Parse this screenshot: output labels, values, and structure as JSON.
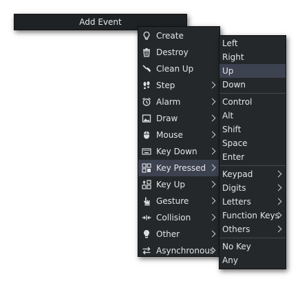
{
  "add_event_label": "Add Event",
  "event_menu": {
    "items": [
      {
        "label": "Create",
        "icon": "lightbulb-icon",
        "submenu": false
      },
      {
        "label": "Destroy",
        "icon": "trash-icon",
        "submenu": false
      },
      {
        "label": "Clean Up",
        "icon": "broom-icon",
        "submenu": false
      },
      {
        "label": "Step",
        "icon": "footprints-icon",
        "submenu": true
      },
      {
        "label": "Alarm",
        "icon": "alarm-clock-icon",
        "submenu": true
      },
      {
        "label": "Draw",
        "icon": "picture-icon",
        "submenu": true
      },
      {
        "label": "Mouse",
        "icon": "mouse-icon",
        "submenu": true
      },
      {
        "label": "Key Down",
        "icon": "keyboard-icon",
        "submenu": true
      },
      {
        "label": "Key Pressed",
        "icon": "key-pressed-icon",
        "submenu": true,
        "highlighted": true
      },
      {
        "label": "Key Up",
        "icon": "key-up-icon",
        "submenu": true
      },
      {
        "label": "Gesture",
        "icon": "hand-pointer-icon",
        "submenu": true
      },
      {
        "label": "Collision",
        "icon": "collision-arrows-icon",
        "submenu": true
      },
      {
        "label": "Other",
        "icon": "lightbulb-filled-icon",
        "submenu": true
      },
      {
        "label": "Asynchronous",
        "icon": "swap-arrows-icon",
        "submenu": true
      }
    ]
  },
  "key_pressed_submenu": {
    "group1": [
      "Left",
      "Right",
      "Up",
      "Down"
    ],
    "highlighted": "Up",
    "group2": [
      "Control",
      "Alt",
      "Shift",
      "Space",
      "Enter"
    ],
    "group3": [
      "Keypad",
      "Digits",
      "Letters",
      "Function Keys",
      "Others"
    ],
    "group4": [
      "No Key",
      "Any"
    ]
  },
  "colors": {
    "menu_bg": "#25282a",
    "highlight_bg": "#3c4250",
    "text": "#e4e4e4"
  }
}
